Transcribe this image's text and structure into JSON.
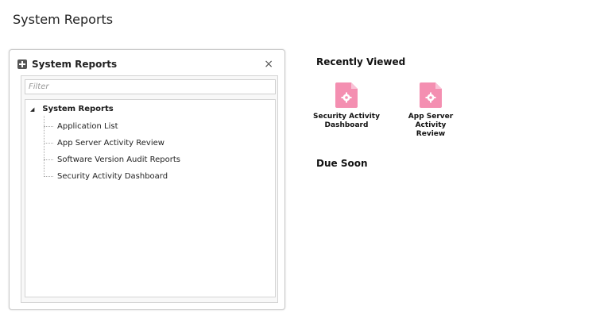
{
  "page": {
    "title": "System Reports"
  },
  "panel": {
    "title": "System Reports",
    "close_glyph": "×",
    "filter": {
      "placeholder": "Filter",
      "value": ""
    },
    "tree": {
      "root_label": "System Reports",
      "toggle_glyph": "◢",
      "items": [
        {
          "label": "Application List"
        },
        {
          "label": "App Server Activity Review"
        },
        {
          "label": "Software Version Audit Reports"
        },
        {
          "label": "Security Activity Dashboard"
        }
      ]
    }
  },
  "recently_viewed": {
    "heading": "Recently Viewed",
    "items": [
      {
        "label_line1": "Security Activity",
        "label_line2": "Dashboard",
        "icon": "report-gear-icon"
      },
      {
        "label_line1": "App Server Activity",
        "label_line2": "Review",
        "icon": "report-gear-icon"
      }
    ]
  },
  "due_soon": {
    "heading": "Due Soon"
  },
  "colors": {
    "report_icon": "#f48fb1",
    "panel_border": "#c9c9c9"
  }
}
